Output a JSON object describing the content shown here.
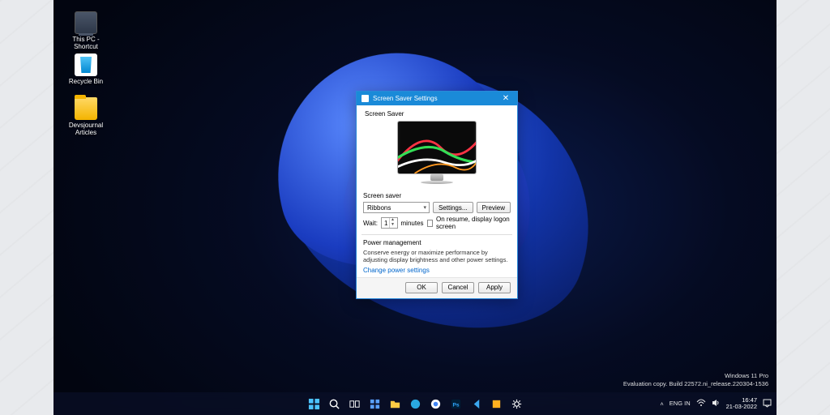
{
  "desktop_icons": [
    {
      "name": "thispc",
      "label": "This PC - Shortcut"
    },
    {
      "name": "recyclebin",
      "label": "Recycle Bin"
    },
    {
      "name": "devjournal",
      "label": "Devsjournal Articles"
    }
  ],
  "dialog": {
    "title": "Screen Saver Settings",
    "group": "Screen Saver",
    "ss_label": "Screen saver",
    "ss_selected": "Ribbons",
    "settings_btn": "Settings...",
    "preview_btn": "Preview",
    "wait_label": "Wait:",
    "wait_value": "1",
    "wait_unit": "minutes",
    "resume_label": "On resume, display logon screen",
    "pm_label": "Power management",
    "pm_desc": "Conserve energy or maximize performance by adjusting display brightness and other power settings.",
    "pm_link": "Change power settings",
    "ok": "OK",
    "cancel": "Cancel",
    "apply": "Apply"
  },
  "watermark": {
    "line1": "Windows 11 Pro",
    "line2": "Evaluation copy. Build 22572.ni_release.220304-1536"
  },
  "tray": {
    "lang": "ENG IN",
    "time": "16:47",
    "date": "21-03-2022"
  }
}
